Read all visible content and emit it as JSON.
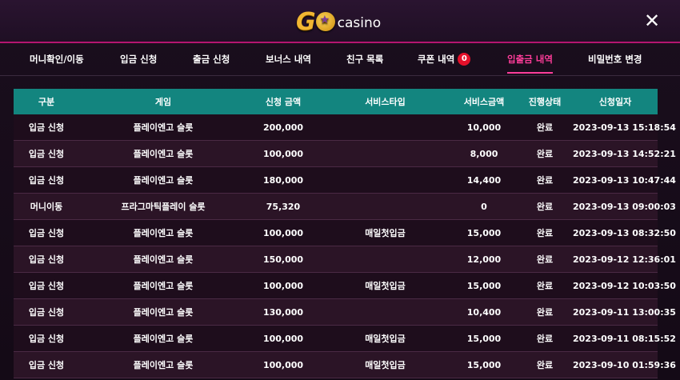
{
  "header": {
    "logo_go": "GO",
    "logo_casino": "casino",
    "close_label": "✕"
  },
  "tabs": [
    {
      "label": "머니확인/이동"
    },
    {
      "label": "입금 신청"
    },
    {
      "label": "출금 신청"
    },
    {
      "label": "보너스 내역"
    },
    {
      "label": "친구 목록"
    },
    {
      "label": "쿠폰 내역",
      "badge": "0"
    },
    {
      "label": "입출금 내역",
      "active": true
    },
    {
      "label": "비밀번호 변경"
    }
  ],
  "table": {
    "columns": [
      "구분",
      "게임",
      "신청 금액",
      "서비스타입",
      "서비스금액",
      "진행상태",
      "신청일자"
    ],
    "rows": [
      [
        "입금 신청",
        "플레이엔고 슬롯",
        "200,000",
        "",
        "10,000",
        "완료",
        "2023-09-13 15:18:54"
      ],
      [
        "입금 신청",
        "플레이엔고 슬롯",
        "100,000",
        "",
        "8,000",
        "완료",
        "2023-09-13 14:52:21"
      ],
      [
        "입금 신청",
        "플레이엔고 슬롯",
        "180,000",
        "",
        "14,400",
        "완료",
        "2023-09-13 10:47:44"
      ],
      [
        "머니이동",
        "프라그마틱플레이 슬롯",
        "75,320",
        "",
        "0",
        "완료",
        "2023-09-13 09:00:03"
      ],
      [
        "입금 신청",
        "플레이엔고 슬롯",
        "100,000",
        "매일첫입금",
        "15,000",
        "완료",
        "2023-09-13 08:32:50"
      ],
      [
        "입금 신청",
        "플레이엔고 슬롯",
        "150,000",
        "",
        "12,000",
        "완료",
        "2023-09-12 12:36:01"
      ],
      [
        "입금 신청",
        "플레이엔고 슬롯",
        "100,000",
        "매일첫입금",
        "15,000",
        "완료",
        "2023-09-12 10:03:50"
      ],
      [
        "입금 신청",
        "플레이엔고 슬롯",
        "130,000",
        "",
        "10,400",
        "완료",
        "2023-09-11 13:00:35"
      ],
      [
        "입금 신청",
        "플레이엔고 슬롯",
        "100,000",
        "매일첫입금",
        "15,000",
        "완료",
        "2023-09-11 08:15:52"
      ],
      [
        "입금 신청",
        "플레이엔고 슬롯",
        "100,000",
        "매일첫입금",
        "15,000",
        "완료",
        "2023-09-10 01:59:36"
      ]
    ]
  },
  "colors": {
    "accent": "#ff3d9a",
    "header_teal": "#13857f",
    "badge_red": "#e4102a",
    "logo_gold": "#f2b632"
  }
}
